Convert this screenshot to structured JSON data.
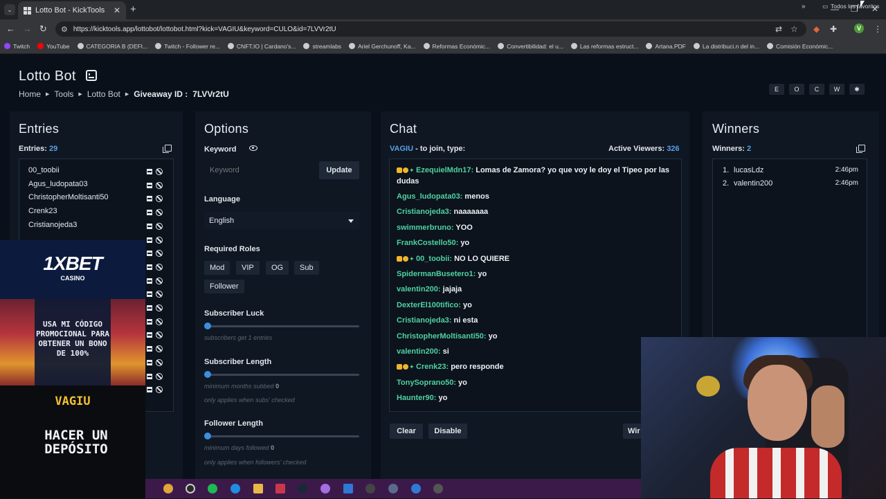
{
  "browser": {
    "tab_title": "Lotto Bot - KickTools",
    "url": "https://kicktools.app/lottobot/lottobot.html?kick=VAGIU&keyword=CULO&id=7LVVr2tU",
    "profile_initial": "V",
    "bookmarks": [
      {
        "label": "Twitch",
        "color": "#9146ff"
      },
      {
        "label": "YouTube",
        "color": "#ff0000"
      },
      {
        "label": "CATEGORIA B (DEFI...",
        "color": "#cccccc"
      },
      {
        "label": "Twitch - Follower re...",
        "color": "#cccccc"
      },
      {
        "label": "CNFT.IO | Cardano's...",
        "color": "#cccccc"
      },
      {
        "label": "streamlabs",
        "color": "#cccccc"
      },
      {
        "label": "Ariel Gerchunoff, Ka...",
        "color": "#cccccc"
      },
      {
        "label": "Reformas Económic...",
        "color": "#cccccc"
      },
      {
        "label": "Convertibilidad: el u...",
        "color": "#cccccc"
      },
      {
        "label": "Las reformas estruct...",
        "color": "#cccccc"
      },
      {
        "label": "Artana.PDF",
        "color": "#cccccc"
      },
      {
        "label": "La distribuci.n del in...",
        "color": "#cccccc"
      },
      {
        "label": "Comisión Económic...",
        "color": "#cccccc"
      }
    ],
    "bookmarks_folder": "Todos los favoritos"
  },
  "page": {
    "title": "Lotto Bot",
    "breadcrumb": {
      "home": "Home",
      "tools": "Tools",
      "lotto": "Lotto Bot",
      "giveaway_label": "Giveaway ID :",
      "giveaway_id": "7LVVr2tU"
    },
    "theme_buttons": [
      "E",
      "O",
      "C",
      "W",
      "✱"
    ]
  },
  "entries": {
    "title": "Entries",
    "count_label": "Entries:",
    "count": "29",
    "visible": [
      "00_toobii",
      "Agus_ludopata03",
      "ChristopherMoltisanti50",
      "Crenk23",
      "Cristianojeda3"
    ]
  },
  "options": {
    "title": "Options",
    "keyword_label": "Keyword",
    "keyword_placeholder": "Keyword",
    "update_label": "Update",
    "language_label": "Language",
    "language_value": "English",
    "roles_label": "Required Roles",
    "roles": [
      "Mod",
      "VIP",
      "OG",
      "Sub",
      "Follower"
    ],
    "sub_luck_label": "Subscriber Luck",
    "sub_luck_hint_pre": "subscribers get",
    "sub_luck_value": "1",
    "sub_luck_hint_post": "entries",
    "sub_length_label": "Subscriber Length",
    "sub_length_hint": "minimum months subbed",
    "sub_length_value": "0",
    "sub_length_note": "only applies when subs' checked",
    "follower_length_label": "Follower Length",
    "follower_length_hint": "minimum days followed",
    "follower_length_value": "0",
    "follower_length_note": "only applies when followers' checked"
  },
  "chat": {
    "title": "Chat",
    "channel": "VAGIU",
    "join_text": "- to join, type:",
    "viewers_label": "Active Viewers:",
    "viewers": "326",
    "messages": [
      {
        "user": "EzequielMdn17:",
        "text": "Lomas de Zamora? yo que voy le doy el Tipeo por las dudas",
        "badges": true
      },
      {
        "user": "Agus_ludopata03:",
        "text": "menos",
        "badges": false
      },
      {
        "user": "Cristianojeda3:",
        "text": "naaaaaaa",
        "badges": false
      },
      {
        "user": "swimmerbruno:",
        "text": "YOO",
        "badges": false
      },
      {
        "user": "FrankCostello50:",
        "text": "yo",
        "badges": false
      },
      {
        "user": "00_toobii:",
        "text": "NO LO QUIERE",
        "badges": true
      },
      {
        "user": "SpidermanBusetero1:",
        "text": "yo",
        "badges": false
      },
      {
        "user": "valentin200:",
        "text": "jajaja",
        "badges": false
      },
      {
        "user": "DexterEl100tifico:",
        "text": "yo",
        "badges": false
      },
      {
        "user": "Cristianojeda3:",
        "text": "ni esta",
        "badges": false
      },
      {
        "user": "ChristopherMoltisanti50:",
        "text": "yo",
        "badges": false
      },
      {
        "user": "valentin200:",
        "text": "si",
        "badges": false
      },
      {
        "user": "Crenk23:",
        "text": "pero responde",
        "badges": true
      },
      {
        "user": "TonySoprano50:",
        "text": "yo",
        "badges": false
      },
      {
        "user": "Haunter90:",
        "text": "yo",
        "badges": false
      }
    ],
    "clear_label": "Clear",
    "disable_label": "Disable",
    "win_label": "Wir"
  },
  "winners": {
    "title": "Winners",
    "count_label": "Winners:",
    "count": "2",
    "list": [
      {
        "idx": "1.",
        "name": "lucasLdz",
        "time": "2:46pm"
      },
      {
        "idx": "2.",
        "name": "valentin200",
        "time": "2:46pm"
      }
    ]
  },
  "ad": {
    "brand": "1XBET",
    "sub": "CASINO",
    "promo": "USA MI CÓDIGO PROMOCIONAL PARA OBTENER UN BONO DE 100%",
    "code": "VAGIU",
    "cta": "HACER UN DEPÓSITO"
  },
  "colors": {
    "accent": "#5aa0e6",
    "chat_user": "#4fd1a0",
    "slider": "#3b8ee0"
  }
}
